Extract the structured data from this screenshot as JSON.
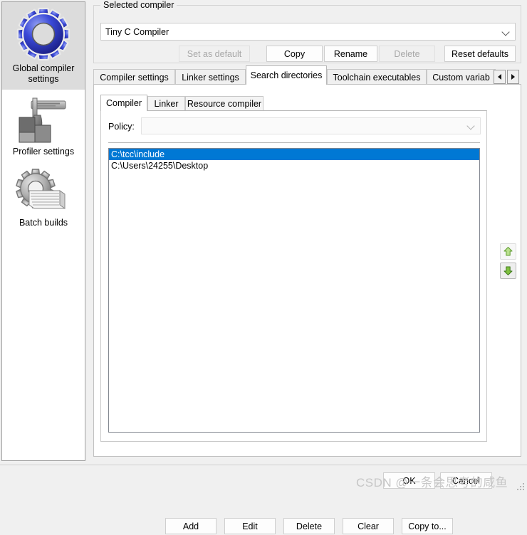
{
  "sidebar": {
    "items": [
      {
        "label": "Global compiler settings",
        "icon": "blue-gear-icon",
        "selected": true
      },
      {
        "label": "Profiler settings",
        "icon": "caliper-blocks-icon",
        "selected": false
      },
      {
        "label": "Batch builds",
        "icon": "gear-pages-icon",
        "selected": false
      }
    ]
  },
  "compiler_group": {
    "title": "Selected compiler",
    "combo_value": "Tiny C Compiler",
    "buttons": [
      {
        "label": "Set as default",
        "enabled": false
      },
      {
        "label": "Copy",
        "enabled": true
      },
      {
        "label": "Rename",
        "enabled": true
      },
      {
        "label": "Delete",
        "enabled": false
      },
      {
        "label": "Reset defaults",
        "enabled": true
      }
    ]
  },
  "outer_tabs": {
    "items": [
      {
        "label": "Compiler settings",
        "active": false
      },
      {
        "label": "Linker settings",
        "active": false
      },
      {
        "label": "Search directories",
        "active": true
      },
      {
        "label": "Toolchain executables",
        "active": false
      },
      {
        "label": "Custom variab",
        "active": false
      }
    ],
    "scroll_left_icon": "arrow-left-icon",
    "scroll_right_icon": "arrow-right-icon"
  },
  "inner_tabs": {
    "items": [
      {
        "label": "Compiler",
        "active": true
      },
      {
        "label": "Linker",
        "active": false
      },
      {
        "label": "Resource compiler",
        "active": false
      }
    ]
  },
  "policy": {
    "label": "Policy:",
    "value": "",
    "placeholder": ""
  },
  "directories": {
    "items": [
      {
        "path": "C:\\tcc\\include",
        "selected": true
      },
      {
        "path": "C:\\Users\\24255\\Desktop",
        "selected": false
      }
    ]
  },
  "move_buttons": {
    "up": {
      "icon": "arrow-up-green-icon",
      "label": "Move up"
    },
    "down": {
      "icon": "arrow-down-green-icon",
      "label": "Move down"
    }
  },
  "dir_actions": {
    "buttons": [
      {
        "label": "Add"
      },
      {
        "label": "Edit"
      },
      {
        "label": "Delete"
      },
      {
        "label": "Clear"
      },
      {
        "label": "Copy to..."
      }
    ]
  },
  "footer": {
    "ok_label": "OK",
    "cancel_label": "Cancel"
  },
  "watermark": {
    "text": "CSDN @一条会思考的咸鱼"
  },
  "colors": {
    "selection_blue": "#0078d4",
    "gear_blue": "#2f3fd0",
    "arrow_green": "#76b843",
    "dialog_bg": "#f0f0f0",
    "panel_white": "#ffffff"
  }
}
